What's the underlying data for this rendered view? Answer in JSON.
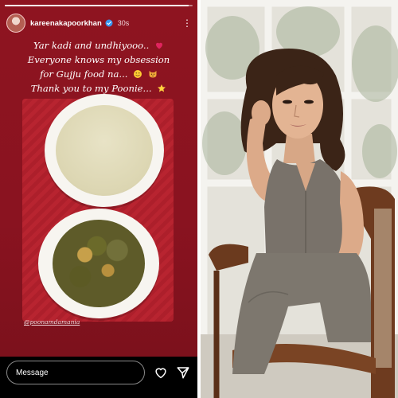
{
  "story": {
    "username": "kareenakapoorkhan",
    "time": "30s",
    "progress": 0.98,
    "caption": {
      "line1": "Yar kadi and undhiyooo..",
      "line2": "Everyone knows my obsession",
      "line3": "for Gujju food na...",
      "line4": "Thank you to my Poonie..."
    },
    "photo_tag": "@poonamdamania",
    "reply_placeholder": "Message"
  },
  "icons": {
    "verified": "verified-badge-icon",
    "more": "more-options-icon",
    "heart": "heart-icon",
    "send": "send-icon"
  },
  "colors": {
    "story_background": "#8e1420",
    "verified": "#3897f0",
    "heart_emoji": "#e0245e"
  }
}
